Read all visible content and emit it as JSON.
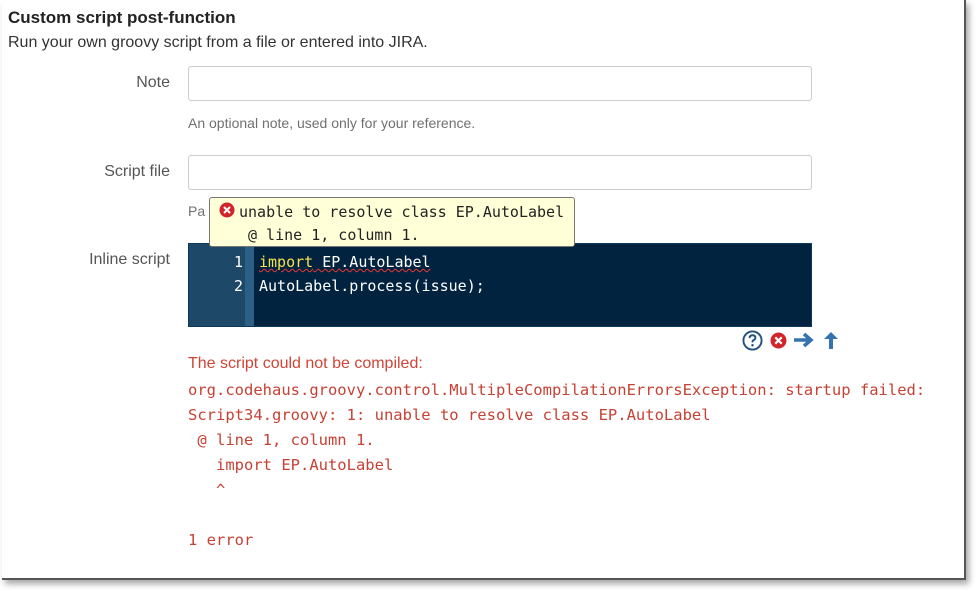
{
  "header": {
    "title": "Custom script post-function",
    "subtitle": "Run your own groovy script from a file or entered into JIRA."
  },
  "form": {
    "note": {
      "label": "Note",
      "value": "",
      "help": "An optional note, used only for your reference."
    },
    "script_file": {
      "label": "Script file",
      "value": "",
      "help_partial": "Pa"
    },
    "inline_script": {
      "label": "Inline script"
    }
  },
  "editor": {
    "lines": [
      {
        "number": "1",
        "keyword": "import",
        "rest": " EP.AutoLabel"
      },
      {
        "number": "2",
        "text": "AutoLabel.process(issue);"
      }
    ],
    "tooltip": {
      "line1": "unable to resolve class EP.AutoLabel",
      "line2": "@ line 1, column 1."
    }
  },
  "toolbar": {
    "icons": [
      "help-icon",
      "error-icon",
      "arrow-right-icon",
      "arrow-up-icon"
    ],
    "colors": {
      "help": "#205081",
      "error": "#d04437",
      "arrow": "#3572b0"
    }
  },
  "errors": {
    "title": "The script could not be compiled:",
    "lines": [
      "org.codehaus.groovy.control.MultipleCompilationErrorsException: startup failed:",
      "Script34.groovy: 1: unable to resolve class EP.AutoLabel",
      " @ line 1, column 1.",
      "   import EP.AutoLabel",
      "   ^",
      "",
      "1 error"
    ]
  },
  "colors": {
    "editor_bg": "#01233f",
    "gutter_bg": "#1d4868",
    "error_text": "#c74134",
    "tooltip_bg": "#ffffd8"
  }
}
